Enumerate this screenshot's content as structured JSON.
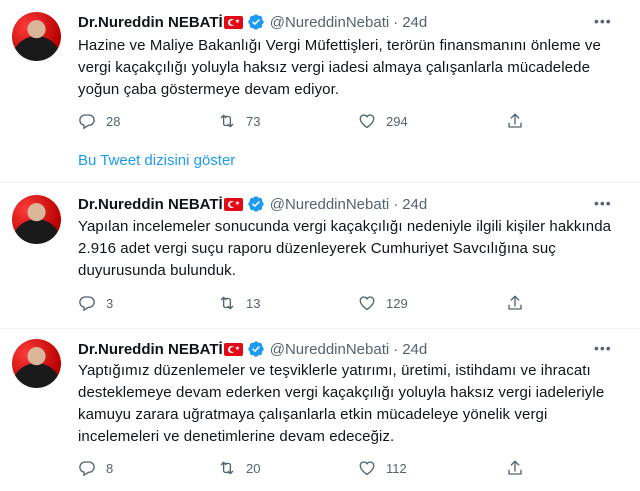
{
  "thread_link": "Bu Tweet dizisini göster",
  "tweets": [
    {
      "name": "Dr.Nureddin NEBATİ",
      "handle": "@NureddinNebati",
      "dot": "·",
      "time": "24d",
      "text": "Hazine ve Maliye Bakanlığı Vergi Müfettişleri, terörün finansmanını önleme ve vergi kaçakçılığı yoluyla haksız vergi iadesi almaya çalışanlarla mücadelede yoğun çaba göstermeye devam ediyor.",
      "replies": "28",
      "retweets": "73",
      "likes": "294"
    },
    {
      "name": "Dr.Nureddin NEBATİ",
      "handle": "@NureddinNebati",
      "dot": "·",
      "time": "24d",
      "text": "Yapılan incelemeler sonucunda vergi kaçakçılığı nedeniyle ilgili kişiler hakkında 2.916 adet vergi suçu raporu düzenleyerek Cumhuriyet Savcılığına suç duyurusunda bulunduk.",
      "replies": "3",
      "retweets": "13",
      "likes": "129"
    },
    {
      "name": "Dr.Nureddin NEBATİ",
      "handle": "@NureddinNebati",
      "dot": "·",
      "time": "24d",
      "text": "Yaptığımız düzenlemeler ve teşviklerle yatırımı, üretimi, istihdamı ve ihracatı desteklemeye devam ederken vergi kaçakçılığı yoluyla haksız vergi iadeleriyle kamuyu zarara uğratmaya çalışanlarla etkin mücadeleye yönelik vergi incelemeleri ve denetimlerine devam edeceğiz.",
      "replies": "8",
      "retweets": "20",
      "likes": "112"
    }
  ],
  "icons": {
    "verified": "verified-badge-icon",
    "flag": "turkey-flag-icon",
    "more": "more-horizontal-icon",
    "reply": "reply-icon",
    "retweet": "retweet-icon",
    "like": "heart-icon",
    "share": "share-icon"
  },
  "colors": {
    "accent": "#1d9bf0",
    "muted": "#536471",
    "flag": "#e30a17"
  }
}
